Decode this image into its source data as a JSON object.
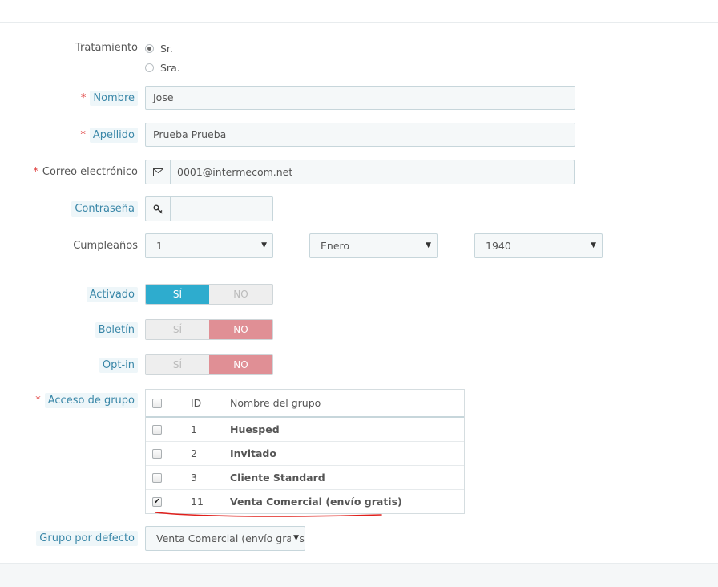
{
  "form": {
    "title_label": "Tratamiento",
    "title_options": [
      {
        "label": "Sr.",
        "checked": true
      },
      {
        "label": "Sra.",
        "checked": false
      }
    ],
    "firstname": {
      "label": "Nombre",
      "value": "Jose",
      "required": "*"
    },
    "lastname": {
      "label": "Apellido",
      "value": "Prueba Prueba",
      "required": "*"
    },
    "email": {
      "label": "Correo electrónico",
      "value": "0001@intermecom.net",
      "required": "*",
      "icon": "envelope-icon"
    },
    "password": {
      "label": "Contraseña",
      "value": "",
      "icon": "key-icon"
    },
    "birthday": {
      "label": "Cumpleaños",
      "day": "1",
      "month": "Enero",
      "year": "1940"
    },
    "active": {
      "label": "Activado",
      "yes": "SÍ",
      "no": "NO",
      "value": "yes"
    },
    "newsletter": {
      "label": "Boletín",
      "yes": "SÍ",
      "no": "NO",
      "value": "no"
    },
    "optin": {
      "label": "Opt-in",
      "yes": "SÍ",
      "no": "NO",
      "value": "no"
    },
    "groups": {
      "label": "Acceso de grupo",
      "required": "*",
      "headers": {
        "id": "ID",
        "name": "Nombre del grupo"
      },
      "rows": [
        {
          "id": "1",
          "name": "Huesped",
          "checked": false
        },
        {
          "id": "2",
          "name": "Invitado",
          "checked": false
        },
        {
          "id": "3",
          "name": "Cliente Standard",
          "checked": false
        },
        {
          "id": "11",
          "name": "Venta Comercial (envío gratis)",
          "checked": true
        }
      ]
    },
    "default_group": {
      "label": "Grupo por defecto",
      "value": "Venta Comercial (envío gratis"
    }
  },
  "colors": {
    "accent_blue": "#2eacce",
    "no_red": "#e08f95",
    "required_red": "#e0403f",
    "hint_text": "#3a87a8",
    "annotation_red": "#e0201c"
  }
}
